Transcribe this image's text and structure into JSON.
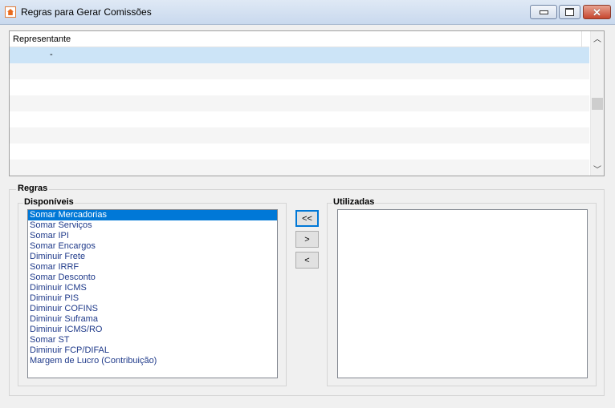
{
  "window": {
    "title": "Regras para Gerar Comissões",
    "icon": "house-icon"
  },
  "grid": {
    "header": "Representante",
    "rows": [
      "-",
      "",
      "",
      "",
      "",
      "",
      "",
      ""
    ]
  },
  "rules": {
    "group_label": "Regras",
    "available_label": "Disponíveis",
    "used_label": "Utilizadas",
    "available_items": [
      "Somar Mercadorias",
      "Somar Serviços",
      "Somar IPI",
      "Somar Encargos",
      "Diminuir Frete",
      "Somar IRRF",
      "Somar Desconto",
      "Diminuir ICMS",
      "Diminuir PIS",
      "Diminuir COFINS",
      "Diminuir Suframa",
      "Diminuir ICMS/RO",
      "Somar ST",
      "Diminuir FCP/DIFAL",
      "Margem de Lucro (Contribuição)"
    ],
    "used_items": [],
    "buttons": {
      "move_all_left": "<<",
      "move_right": ">",
      "move_left": "<"
    }
  },
  "colors": {
    "selection": "#0078d7",
    "row_selected": "#cce4f7"
  }
}
